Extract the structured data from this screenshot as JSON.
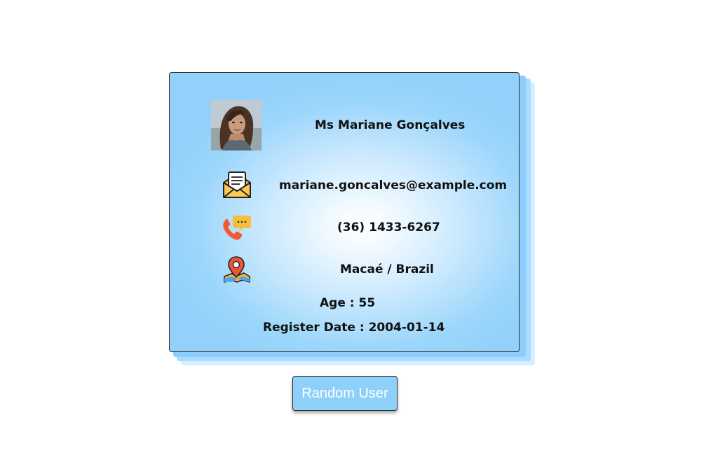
{
  "user": {
    "full_name": "Ms Mariane Gonçalves",
    "email": "mariane.goncalves@example.com",
    "phone": "(36) 1433-6267",
    "location": "Macaé / Brazil",
    "age_text": "Age : 55",
    "register_text": "Register Date : 2004-01-14"
  },
  "icons": {
    "avatar": "user-photo",
    "email": "envelope-letter-icon",
    "phone": "phone-chat-icon",
    "location": "map-pin-icon"
  },
  "actions": {
    "random_user_label": "Random User"
  },
  "colors": {
    "card_border": "#2b2b2b",
    "card_edge": "#93d1fa",
    "button_bg": "#8fd0fb",
    "button_text": "#ffffff"
  }
}
